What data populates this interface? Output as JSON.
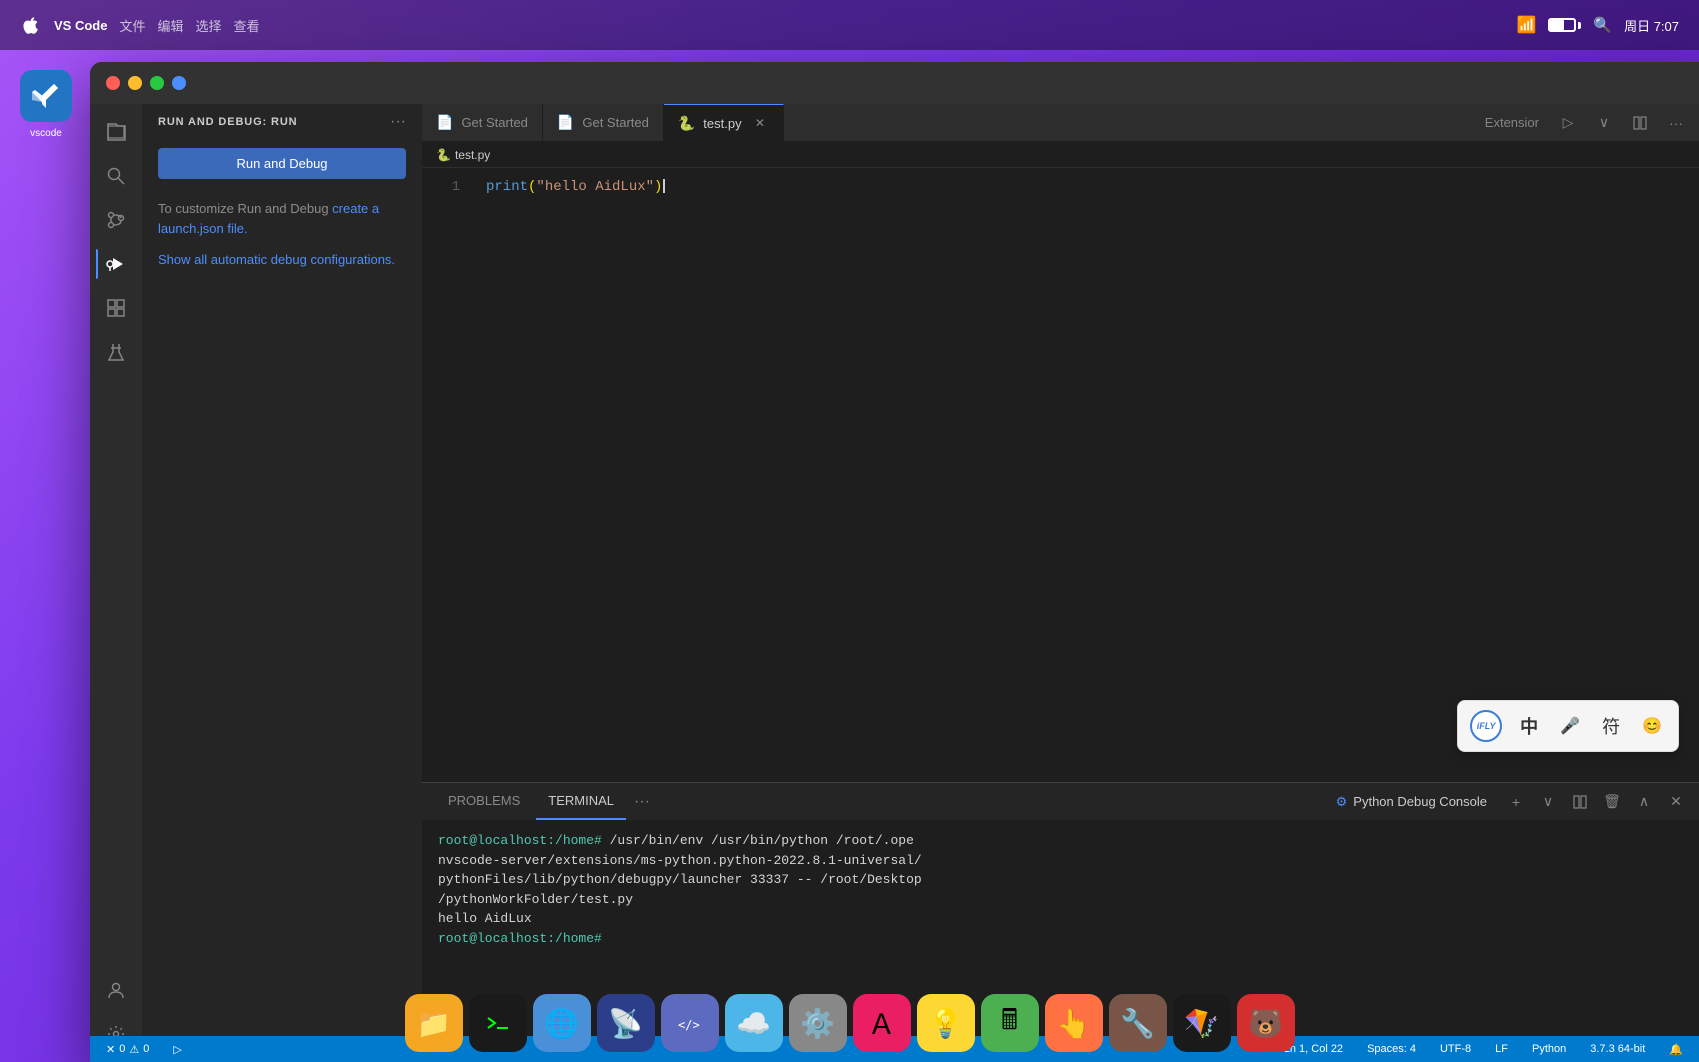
{
  "macos": {
    "time": "周日 7:07",
    "wifi": "wifi",
    "battery": "55"
  },
  "vscode": {
    "label": "vscode"
  },
  "titlebar": {
    "traffic": [
      "red",
      "yellow",
      "green",
      "blue"
    ]
  },
  "activity_bar": {
    "icons": [
      {
        "name": "explorer-icon",
        "symbol": "⎘",
        "active": false
      },
      {
        "name": "search-icon",
        "symbol": "🔍",
        "active": false
      },
      {
        "name": "source-control-icon",
        "symbol": "⎇",
        "active": false
      },
      {
        "name": "run-debug-icon",
        "symbol": "▷",
        "active": true
      },
      {
        "name": "extensions-icon",
        "symbol": "⊞",
        "active": false
      },
      {
        "name": "test-icon",
        "symbol": "⚗",
        "active": false
      },
      {
        "name": "account-icon",
        "symbol": "👤",
        "active": false
      },
      {
        "name": "settings-icon",
        "symbol": "⚙",
        "active": false
      }
    ]
  },
  "sidebar": {
    "title": "RUN AND DEBUG: RUN",
    "more_label": "···",
    "run_button": "Run and Debug",
    "description": "To customize Run and Debug ",
    "link_text": "create a launch.json file.",
    "auto_debug_text": "Show all automatic debug configurations."
  },
  "tabs": [
    {
      "label": "Get Started",
      "icon": "📄",
      "active": false,
      "closeable": false
    },
    {
      "label": "Get Started",
      "icon": "📄",
      "active": false,
      "closeable": false
    },
    {
      "label": "test.py",
      "icon": "🐍",
      "active": true,
      "closeable": true
    }
  ],
  "tab_bar_right": {
    "run_label": "▷",
    "split_label": "⊟",
    "more_label": "···"
  },
  "breadcrumb": {
    "file": "test.py",
    "icon": "🐍"
  },
  "editor": {
    "filename": "test.py",
    "lines": [
      {
        "number": 1,
        "content": "print(\"hello AidLux\")"
      }
    ]
  },
  "terminal": {
    "tabs": [
      {
        "label": "PROBLEMS",
        "active": false
      },
      {
        "label": "TERMINAL",
        "active": true
      }
    ],
    "more_label": "···",
    "python_debug_label": "Python Debug Console",
    "actions": {
      "add": "+",
      "chevron": "∨",
      "split": "⊞",
      "trash": "🗑",
      "collapse": "∧",
      "close": "×"
    },
    "output": [
      {
        "type": "prompt",
        "prompt": "root@localhost:/home#",
        "cmd": " /usr/bin/env /usr/bin/python /root/.openvscode-server/extensions/ms-python.python-2022.8.1-universal/pythonFiles/lib/python/debugpy/launcher 33337 -- /root/Desktop/pythonWorkFolder/test.py"
      },
      {
        "type": "output",
        "text": "hello AidLux"
      },
      {
        "type": "prompt2",
        "prompt": "root@localhost:/home#",
        "cmd": ""
      }
    ]
  },
  "ime": {
    "logo": "iFLY",
    "zh_label": "中",
    "mic_label": "🎤",
    "symbol_label": "符",
    "emoji_label": "😊"
  },
  "status_bar": {
    "error_icon": "✕",
    "error_count": "0",
    "warning_icon": "⚠",
    "warning_count": "0",
    "debug_icon": "▷",
    "position": "Ln 1, Col 22",
    "spaces": "Spaces: 4",
    "encoding": "UTF-8",
    "line_ending": "LF",
    "language": "Python",
    "python_version": "3.7.3 64-bit",
    "bell_icon": "🔔"
  },
  "dock": {
    "items": [
      {
        "name": "files-icon",
        "color": "#f5a623",
        "symbol": "📁"
      },
      {
        "name": "terminal-icon",
        "color": "#2c2c2c",
        "symbol": "🖥"
      },
      {
        "name": "network-icon",
        "color": "#4a90d9",
        "symbol": "🌐"
      },
      {
        "name": "remote-icon",
        "color": "#3b7dd8",
        "symbol": "📡"
      },
      {
        "name": "code-icon",
        "color": "#5c6bc0",
        "symbol": "</>"
      },
      {
        "name": "cloud-icon",
        "color": "#4db6e8",
        "symbol": "☁"
      },
      {
        "name": "settings-app-icon",
        "color": "#aaa",
        "symbol": "⚙"
      },
      {
        "name": "font-icon",
        "color": "#e91e63",
        "symbol": "Ａ"
      },
      {
        "name": "bulb-icon",
        "color": "#fdd835",
        "symbol": "💡"
      },
      {
        "name": "calc-icon",
        "color": "#4caf50",
        "symbol": "🖩"
      },
      {
        "name": "touch-icon",
        "color": "#ff7043",
        "symbol": "👆"
      },
      {
        "name": "tools-icon",
        "color": "#795548",
        "symbol": "🔧"
      },
      {
        "name": "kite-icon",
        "color": "#2c2c2c",
        "symbol": "🪁"
      },
      {
        "name": "kuma-icon",
        "color": "#d32f2f",
        "symbol": "🐻"
      }
    ]
  }
}
